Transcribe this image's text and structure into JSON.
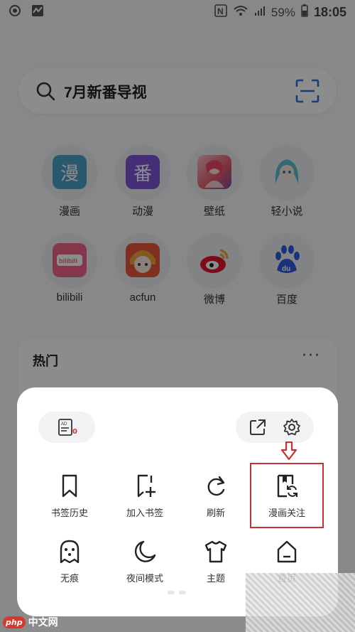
{
  "status_bar": {
    "battery": "59%",
    "time": "18:05"
  },
  "search": {
    "text": "7月新番导视"
  },
  "shortcuts": [
    {
      "label": "漫画",
      "icon": "manga-icon",
      "glyph": "漫",
      "color": "#4aa3c8"
    },
    {
      "label": "动漫",
      "icon": "anime-icon",
      "glyph": "番",
      "color": "#7e55d8"
    },
    {
      "label": "壁纸",
      "icon": "wallpaper-icon",
      "color": "#e35b6c"
    },
    {
      "label": "轻小说",
      "icon": "light-novel-icon",
      "color": "#5cc0cf"
    },
    {
      "label": "bilibili",
      "icon": "bilibili-icon",
      "color": "#f06589"
    },
    {
      "label": "acfun",
      "icon": "acfun-icon",
      "color": "#e8553b"
    },
    {
      "label": "微博",
      "icon": "weibo-icon",
      "color": "#e6162d"
    },
    {
      "label": "百度",
      "icon": "baidu-icon",
      "color": "#2f5ee0"
    }
  ],
  "hot": {
    "title": "热门",
    "more": "···"
  },
  "menu": {
    "bookmark_count": "0",
    "items": [
      {
        "label": "书签历史",
        "icon": "bookmark-icon"
      },
      {
        "label": "加入书签",
        "icon": "add-bookmark-icon"
      },
      {
        "label": "刷新",
        "icon": "refresh-icon"
      },
      {
        "label": "漫画关注",
        "icon": "manga-follow-icon"
      },
      {
        "label": "无痕",
        "icon": "ghost-icon"
      },
      {
        "label": "夜间模式",
        "icon": "moon-icon"
      },
      {
        "label": "主题",
        "icon": "shirt-icon"
      },
      {
        "label": "首页",
        "icon": "home-icon"
      }
    ]
  },
  "watermark": {
    "badge": "php",
    "site": "中文网"
  },
  "colors": {
    "highlight": "#c43333",
    "overlay": "rgba(0,0,0,0.45)"
  }
}
